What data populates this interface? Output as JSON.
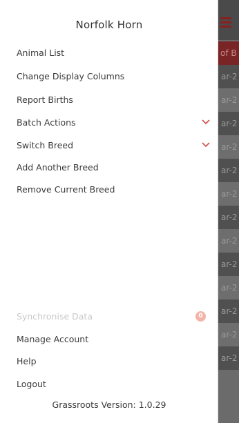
{
  "drawer": {
    "title": "Norfolk Horn",
    "menu": [
      {
        "label": "Animal List"
      },
      {
        "label": "Change Display Columns"
      },
      {
        "label": "Report Births"
      },
      {
        "label": "Batch Actions",
        "icon": "chevron-down-icon"
      },
      {
        "label": "Switch Breed",
        "icon": "chevron-down-icon"
      },
      {
        "label": "Add Another Breed"
      },
      {
        "label": "Remove Current Breed"
      }
    ],
    "bottom_menu": [
      {
        "label": "Synchronise Data",
        "state": "disabled",
        "badge": "0"
      },
      {
        "label": "Manage Account"
      },
      {
        "label": "Help"
      },
      {
        "label": "Logout"
      }
    ],
    "version": "Grassroots Version: 1.0.29"
  },
  "background_app": {
    "column_header": "of B",
    "rows": [
      "ar-2",
      "ar-2",
      "ar-2",
      "ar-2",
      "ar-2",
      "ar-2",
      "ar-2",
      "ar-2",
      "ar-2",
      "ar-2",
      "ar-2",
      "ar-2",
      "ar-2"
    ]
  },
  "colors": {
    "accent": "#c0392b",
    "header_bar": "#7a2525",
    "overlay": "#6b6b6b",
    "badge": "#f4b3a8"
  }
}
